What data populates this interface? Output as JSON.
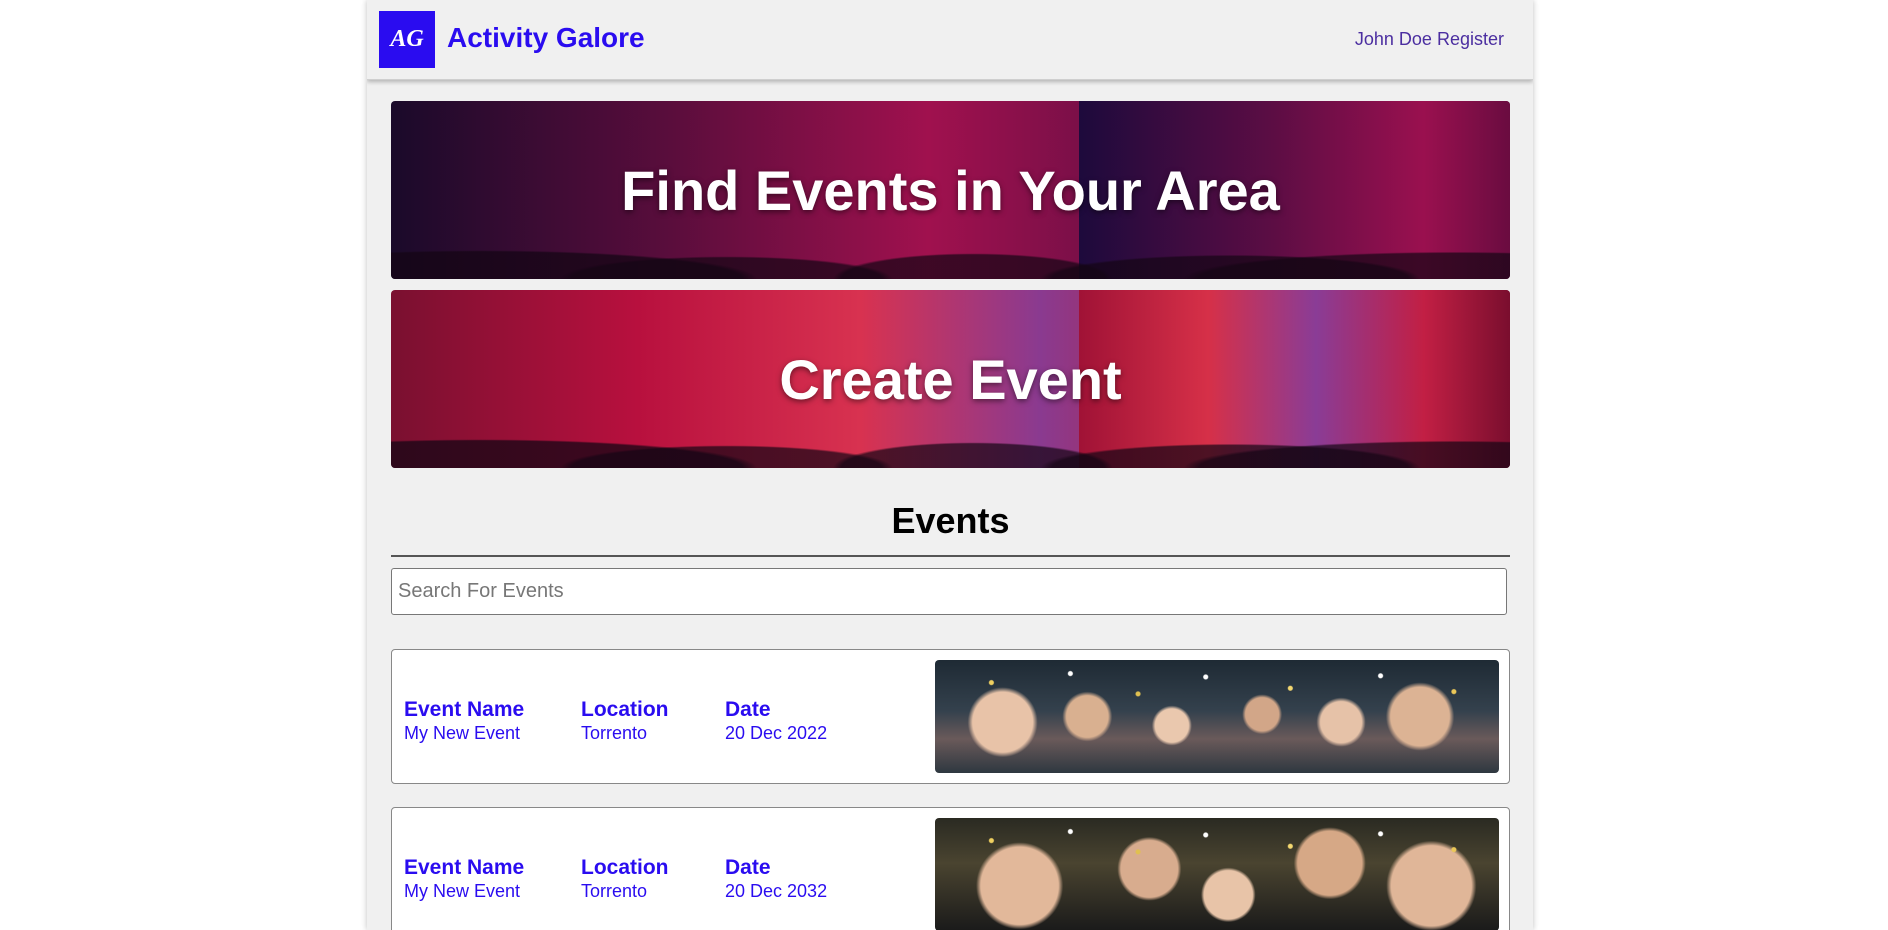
{
  "header": {
    "logo_text": "AG",
    "brand": "Activity Galore",
    "user_name": "John Doe",
    "register_label": "Register"
  },
  "banners": {
    "find_events": "Find Events in Your Area",
    "create_event": "Create Event"
  },
  "events_section": {
    "heading": "Events",
    "search_placeholder": "Search For Events",
    "search_value": ""
  },
  "columns": {
    "name": "Event Name",
    "location": "Location",
    "date": "Date"
  },
  "events": [
    {
      "name": "My New Event",
      "location": "Torrento",
      "date": "20 Dec 2022"
    },
    {
      "name": "My New Event",
      "location": "Torrento",
      "date": "20 Dec 2032"
    }
  ],
  "colors": {
    "brand": "#2a0cf0",
    "nav_link": "#4b2ea0",
    "page_bg": "#f0f0f0"
  }
}
